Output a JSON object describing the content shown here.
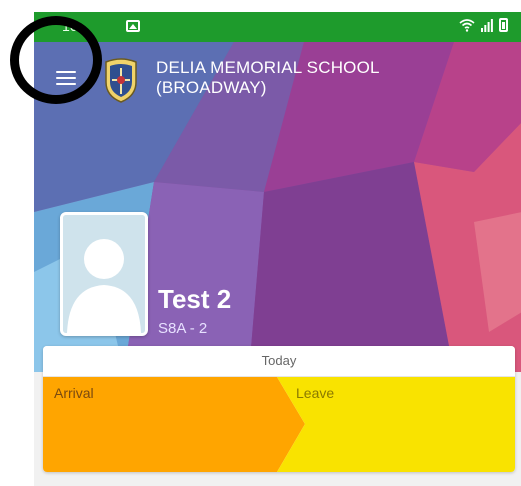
{
  "status_bar": {
    "time": "16:",
    "icons": [
      "image-icon",
      "wifi-icon",
      "signal-icon",
      "battery-icon"
    ]
  },
  "header": {
    "menu_icon": "hamburger-menu-icon",
    "crest_icon": "school-crest-icon",
    "school_name_line1": "DELIA MEMORIAL SCHOOL",
    "school_name_line2": "(BROADWAY)"
  },
  "profile": {
    "name": "Test 2",
    "class": "S8A - 2",
    "avatar_icon": "default-avatar-icon"
  },
  "attendance": {
    "header": "Today",
    "arrival_label": "Arrival",
    "leave_label": "Leave",
    "arrival_color": "#ffa500",
    "leave_color": "#f9e300"
  },
  "colors": {
    "status_bar": "#1e9b2c",
    "hero_base": "#8a4aa0"
  }
}
